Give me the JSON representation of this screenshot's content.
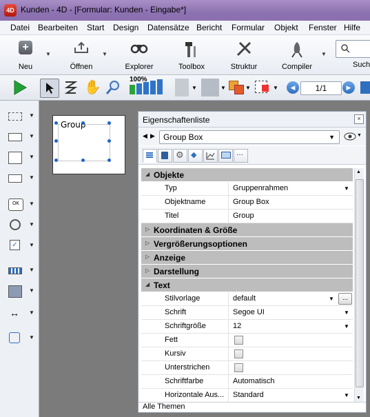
{
  "window": {
    "title": "Kunden - 4D - [Formular: Kunden -  Eingabe*]",
    "logo_text": "4D"
  },
  "menu": [
    "Datei",
    "Bearbeiten",
    "Start",
    "Design",
    "Datensätze",
    "Bericht",
    "Formular",
    "Objekt",
    "Fenster",
    "Hilfe"
  ],
  "toolbar": {
    "buttons": [
      "Neu",
      "Öffnen",
      "Explorer",
      "Toolbox",
      "Struktur",
      "Compiler",
      "Such"
    ],
    "zoom_label": "100%",
    "page_counter": "1/1"
  },
  "form": {
    "group_title": "Group"
  },
  "panel": {
    "title": "Eigenschaftenliste",
    "close_glyph": "×",
    "object_select": "Group Box",
    "sections": {
      "objekte": "Objekte",
      "koordinaten": "Koordinaten & Größe",
      "vergroesserung": "Vergrößerungsoptionen",
      "anzeige": "Anzeige",
      "darstellung": "Darstellung",
      "text": "Text"
    },
    "objekte_rows": [
      {
        "key": "Typ",
        "value": "Gruppenrahmen"
      },
      {
        "key": "Objektname",
        "value": "Group Box"
      },
      {
        "key": "Titel",
        "value": "Group"
      }
    ],
    "text_rows": [
      {
        "key": "Stilvorlage",
        "value": "default"
      },
      {
        "key": "Schrift",
        "value": "Segoe UI"
      },
      {
        "key": "Schriftgröße",
        "value": "12"
      },
      {
        "key": "Fett",
        "value": ""
      },
      {
        "key": "Kursiv",
        "value": ""
      },
      {
        "key": "Unterstrichen",
        "value": ""
      },
      {
        "key": "Schriftfarbe",
        "value": "Automatisch"
      },
      {
        "key": "Horizontale Aus...",
        "value": "Standard"
      }
    ],
    "footer": "Alle Themen"
  },
  "colors": {
    "title_bar": "#8d72b1",
    "section_bg": "#bdbdbd",
    "handle": "#1f66c8",
    "canvas": "#7b7b7b"
  }
}
